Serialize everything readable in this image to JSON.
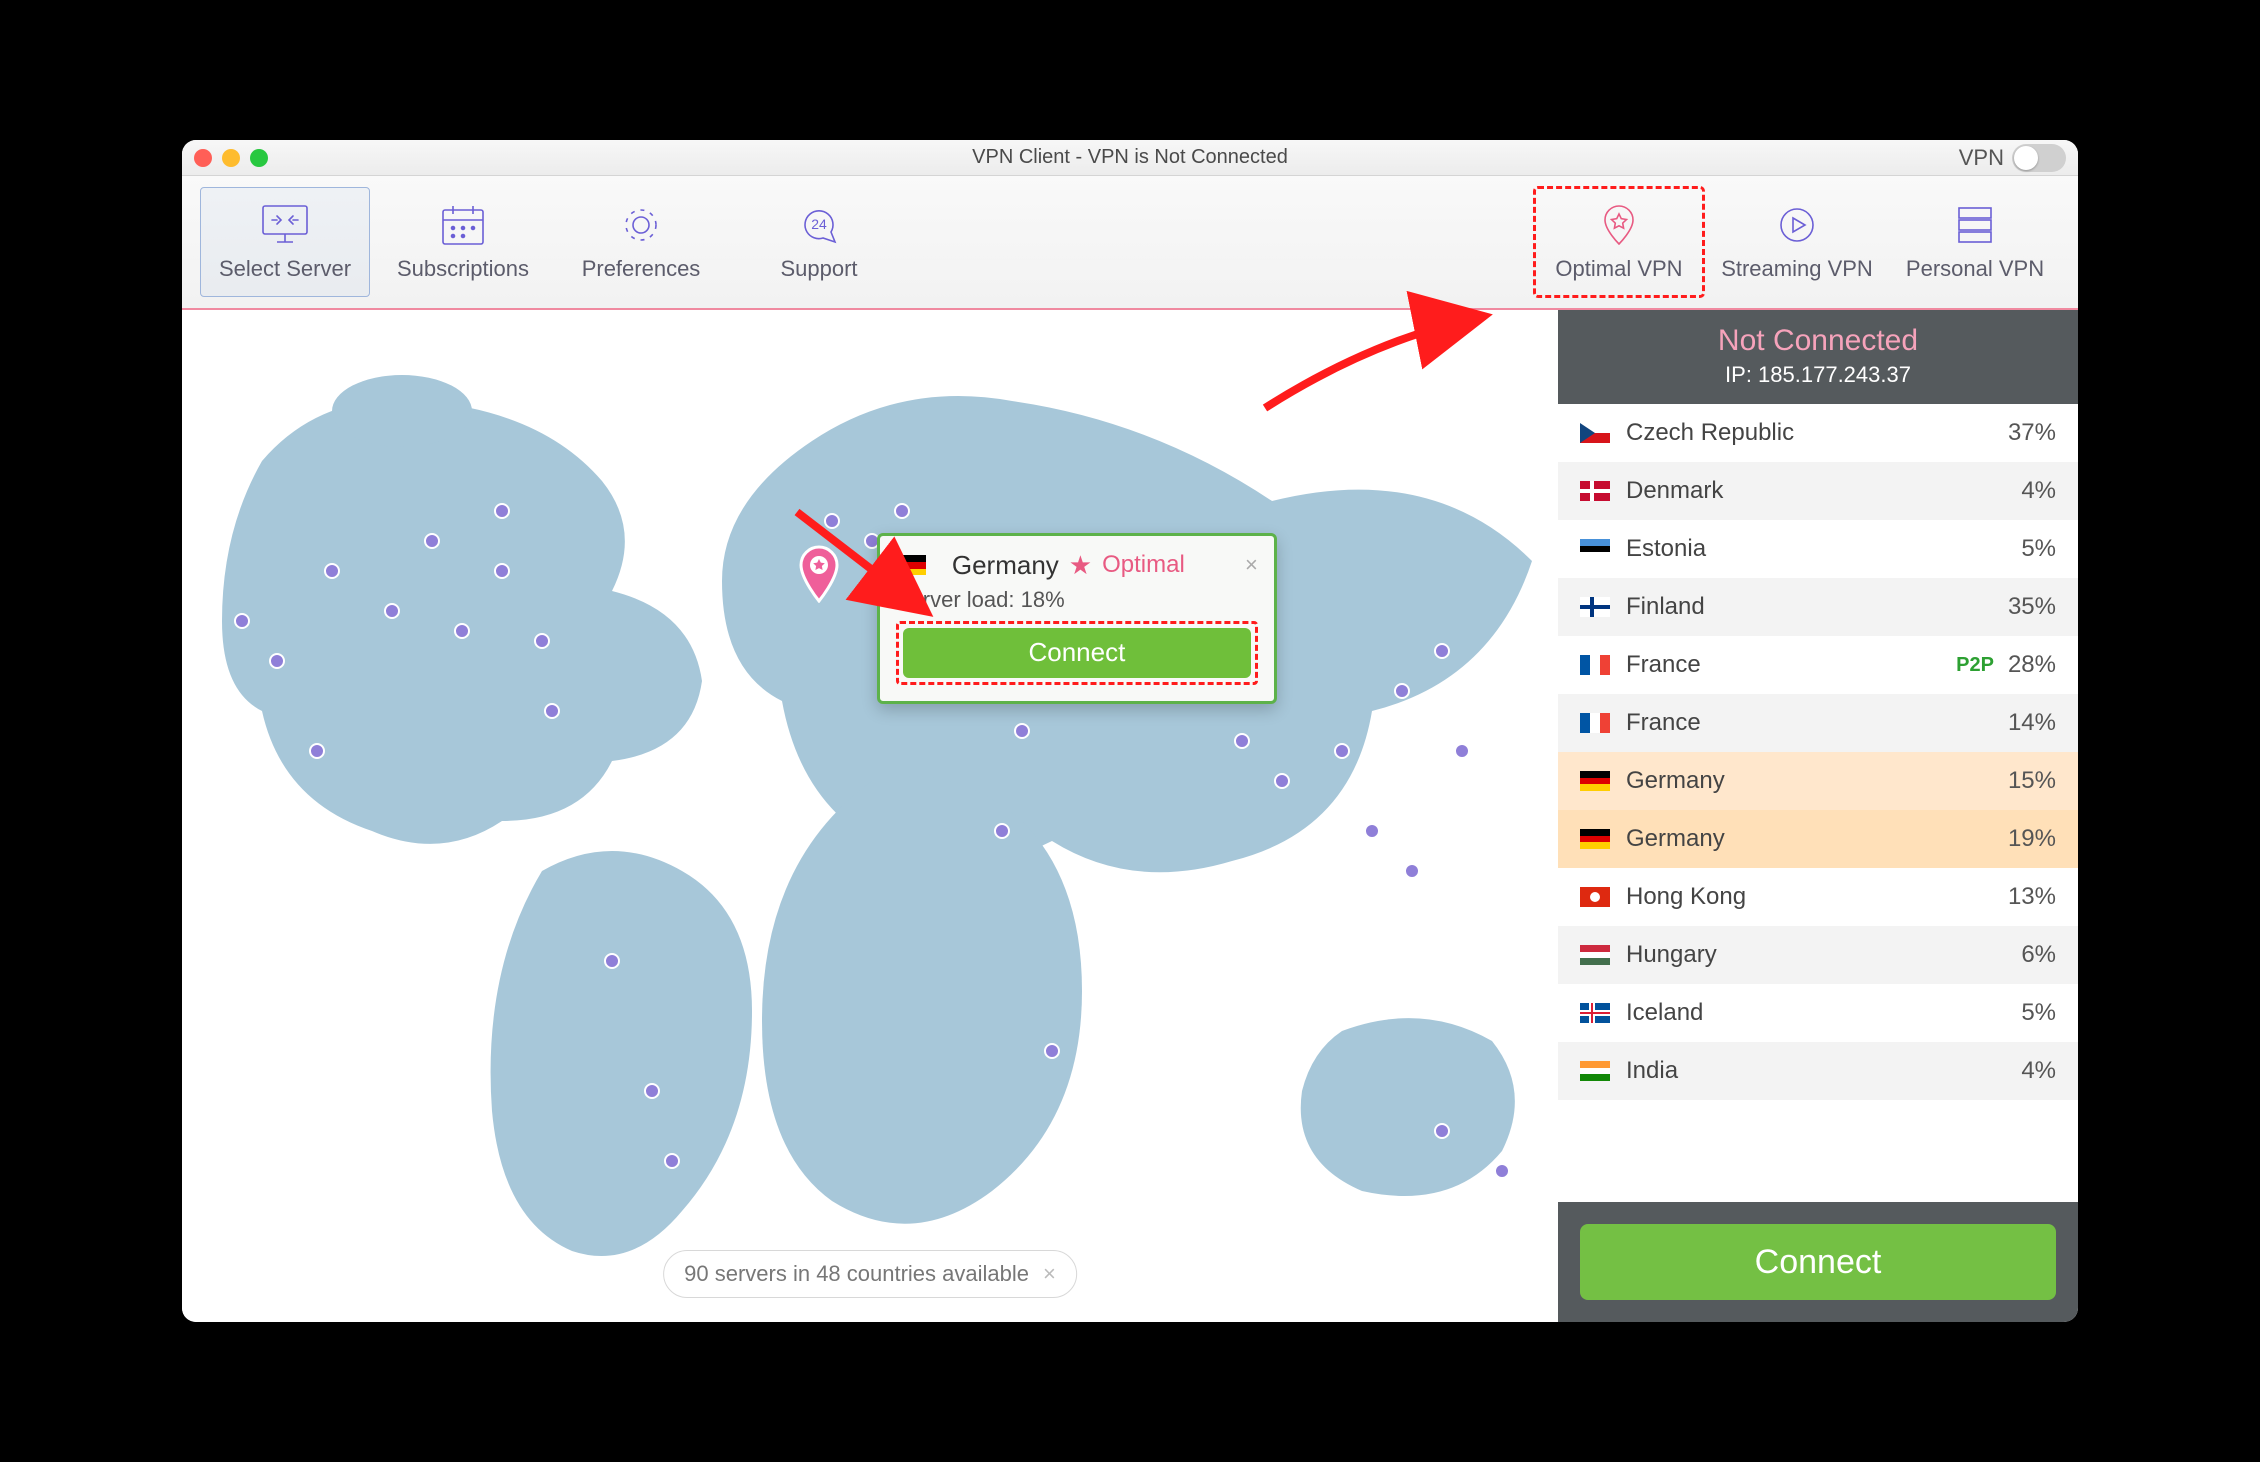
{
  "window": {
    "title": "VPN Client - VPN is Not Connected",
    "vpn_label": "VPN"
  },
  "toolbar": {
    "select_server": "Select Server",
    "subscriptions": "Subscriptions",
    "preferences": "Preferences",
    "support": "Support",
    "optimal": "Optimal VPN",
    "streaming": "Streaming VPN",
    "personal": "Personal VPN"
  },
  "popup": {
    "country": "Germany",
    "tag": "Optimal",
    "star": "★",
    "load_label": "Server load:",
    "load_value": "18%",
    "connect": "Connect"
  },
  "pill": {
    "text": "90 servers in 48 countries available"
  },
  "side": {
    "status": "Not Connected",
    "ip_label": "IP: 185.177.243.37",
    "connect": "Connect"
  },
  "servers": [
    {
      "name": "Czech Republic",
      "load": "37%",
      "flag": "cz"
    },
    {
      "name": "Denmark",
      "load": "4%",
      "flag": "dk"
    },
    {
      "name": "Estonia",
      "load": "5%",
      "flag": "ee"
    },
    {
      "name": "Finland",
      "load": "35%",
      "flag": "fi"
    },
    {
      "name": "France",
      "load": "28%",
      "flag": "fr",
      "p2p": "P2P"
    },
    {
      "name": "France",
      "load": "14%",
      "flag": "fr"
    },
    {
      "name": "Germany",
      "load": "15%",
      "flag": "de",
      "hl": 1
    },
    {
      "name": "Germany",
      "load": "19%",
      "flag": "de",
      "hl": 2
    },
    {
      "name": "Hong Kong",
      "load": "13%",
      "flag": "hk"
    },
    {
      "name": "Hungary",
      "load": "6%",
      "flag": "hu"
    },
    {
      "name": "Iceland",
      "load": "5%",
      "flag": "is"
    },
    {
      "name": "India",
      "load": "4%",
      "flag": "in"
    }
  ]
}
